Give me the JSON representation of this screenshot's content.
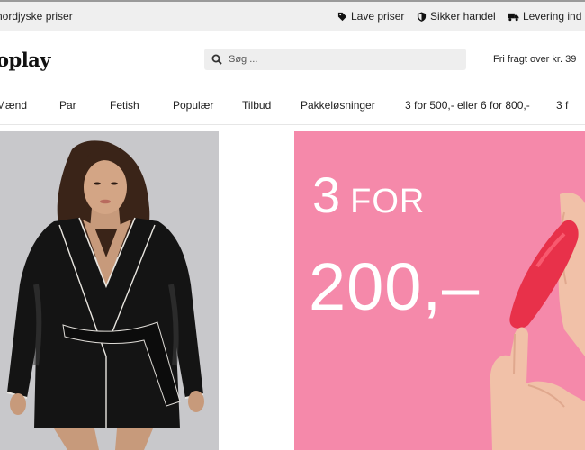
{
  "topbar": {
    "left_note": "nordjyske priser",
    "usps": [
      {
        "icon": "tag-icon",
        "label": "Lave priser"
      },
      {
        "icon": "shield-icon",
        "label": "Sikker handel"
      },
      {
        "icon": "truck-icon",
        "label": "Levering ind"
      }
    ]
  },
  "header": {
    "logo": "oplay",
    "search_placeholder": "Søg ...",
    "shipping_note": "Fri fragt over kr. 39"
  },
  "nav": {
    "items": [
      "Mænd",
      "Par",
      "Fetish",
      "Populær",
      "Tilbud",
      "Pakkeløsninger",
      "3 for 500,- eller 6 for 800,-",
      "3 f"
    ]
  },
  "promo": {
    "line1_number": "3",
    "line1_word": "FOR",
    "price": "200,–"
  },
  "colors": {
    "promo_bg": "#f589aa",
    "topbar_bg": "#efefef",
    "search_bg": "#eeeeee"
  }
}
